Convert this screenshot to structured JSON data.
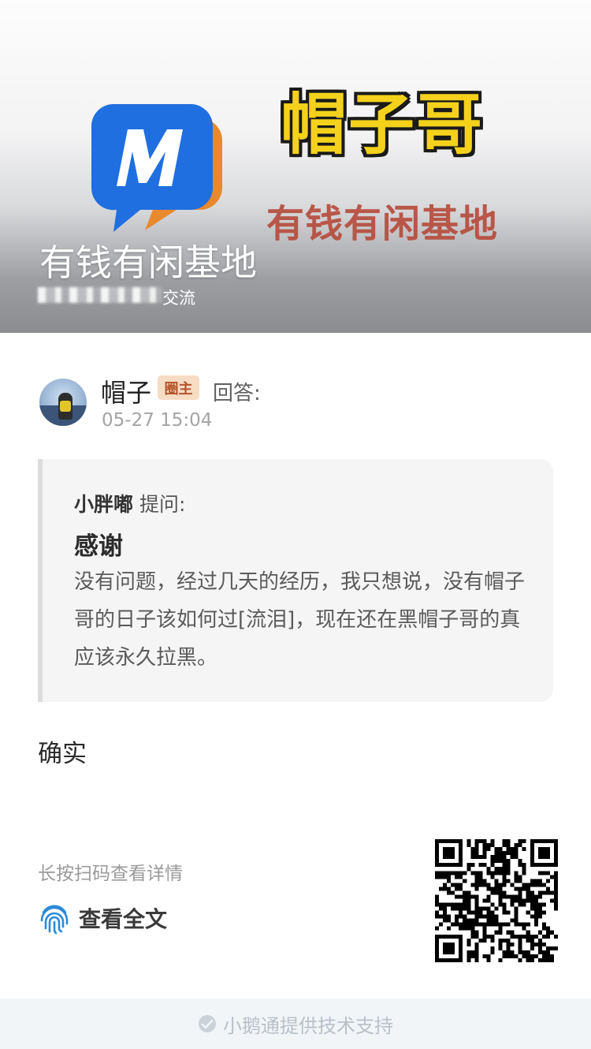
{
  "banner": {
    "brand_title": "帽子哥",
    "brand_sub": "有钱有闲基地",
    "group_name": "有钱有闲基地",
    "group_desc": "交流"
  },
  "answer": {
    "author": "帽子",
    "role_badge": "圈主",
    "verb": "回答:",
    "timestamp": "05-27 15:04",
    "text": "确实"
  },
  "question": {
    "asker": "小胖嘟",
    "asker_suffix": "提问:",
    "title": "感谢",
    "body": "没有问题，经过几天的经历，我只想说，没有帽子哥的日子该如何过[流泪]，现在还在黑帽子哥的真应该永久拉黑。"
  },
  "footer": {
    "scan_hint": "长按扫码查看详情",
    "view_full_label": "查看全文",
    "support_text": "小鹅通提供技术支持"
  },
  "colors": {
    "badge_bg": "#f7dcc4",
    "badge_text": "#b4542a",
    "logo_blue": "#1f6fe0",
    "logo_orange": "#e8892d",
    "fingerprint_blue": "#2a8bd8"
  },
  "icons": [
    "app-logo-icon",
    "fingerprint-icon",
    "qr-code",
    "support-logo-icon"
  ]
}
